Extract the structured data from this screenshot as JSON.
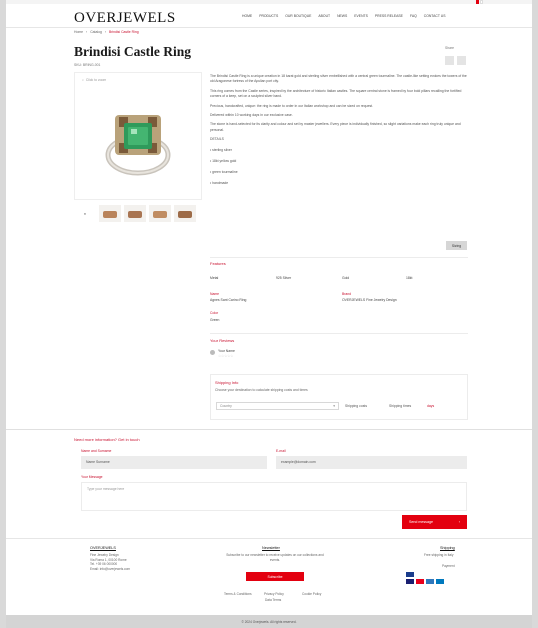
{
  "header": {
    "logo": "OVERJEWELS",
    "nav": [
      "HOME",
      "PRODUCTS",
      "OUR BOUTIQUE",
      "ABOUT",
      "NEWS",
      "EVENTS",
      "PRESS RELEASE",
      "FAQ",
      "CONTACT US"
    ]
  },
  "breadcrumb": [
    "Home",
    "Catalog",
    "Brindisi Castle Ring"
  ],
  "product": {
    "title": "Brindisi Castle Ring",
    "sku": "SKU: BRING-001",
    "share_label": "Share",
    "zoom_label": "Click to zoom",
    "description": [
      "The Brindisi Castle Ring is a unique creation in 18 karat gold and sterling silver embellished with a central green tourmaline. The castle-like setting evokes the towers of the old Aragonese fortress of the Apulian port city.",
      "This ring comes from the Castle series, inspired by the architecture of historic Italian castles. The square central stone is framed by four bold pillars recalling the fortified corners of a keep, set on a sculpted silver band.",
      "Precious, handcrafted, unique: the ring is made to order in our Italian workshop and can be sized on request.",
      "Delivered within 10 working days in our exclusive case.",
      "The stone is hand-selected for its clarity and colour and set by master jewellers. Every piece is individually finished, so slight variations make each ring truly unique and personal."
    ],
    "details_title": "DETAILS",
    "details": [
      "• sterling silver",
      "• 18kt yellow gold",
      "• green tourmaline",
      "• handmade"
    ],
    "more_button": "Sizing"
  },
  "features": {
    "title": "Features",
    "specs": [
      {
        "label": "Metal",
        "value": "925 Silver"
      },
      {
        "label": "Gold",
        "value": "18kt"
      },
      {
        "label": "Stone",
        "value": "Green Tourmaline"
      },
      {
        "label": "Finish",
        "value": "Polished"
      }
    ],
    "name_label": "Name",
    "name_value": "Agnes Sant Carino Ring",
    "brand_label": "Brand",
    "brand_value": "OVERJEWELS Fine Jewelry Design",
    "color_label": "Color",
    "color_value": "Green"
  },
  "reviews": {
    "title": "Your Reviews",
    "author": "Your Name",
    "stars": "☆☆☆☆☆"
  },
  "shipping": {
    "title": "Shipping Info",
    "subtitle": "Choose your destination to calculate shipping costs and times",
    "select_placeholder": "Country",
    "shipping_label": "Shipping costs",
    "time_label": "Shipping times",
    "time_value": "days"
  },
  "contact_form": {
    "title": "Need more information? Get in touch",
    "name_label": "Name and Surname",
    "name_value": "Name Surname",
    "email_label": "E-mail",
    "email_value": "example@domain.com",
    "message_label": "Your Message",
    "message_placeholder": "Type your message here",
    "send_label": "Send message"
  },
  "footer": {
    "brand": "OVERJEWELS",
    "address": [
      "Fine Jewelry Design",
      "Via Roma 1, 00100 Rome",
      "Tel. +39 06 000000",
      "Email: info@overjewels.com"
    ],
    "newsletter_title": "Newsletter",
    "newsletter_text": "Subscribe to our newsletter to receive updates on our collections and events.",
    "subscribe_label": "Subscribe",
    "links": [
      "Terms & Conditions",
      "Privacy Policy",
      "Cookie Policy",
      "Data Terms"
    ],
    "shipping_title": "Shipping",
    "shipping_text": "Free shipping in Italy",
    "payment_title": "Payment",
    "copyright": "© 2024 Overjewels. All rights reserved."
  },
  "colors": {
    "accent": "#e3000f",
    "label": "#c8102e",
    "stone": "#2f9a5b"
  }
}
